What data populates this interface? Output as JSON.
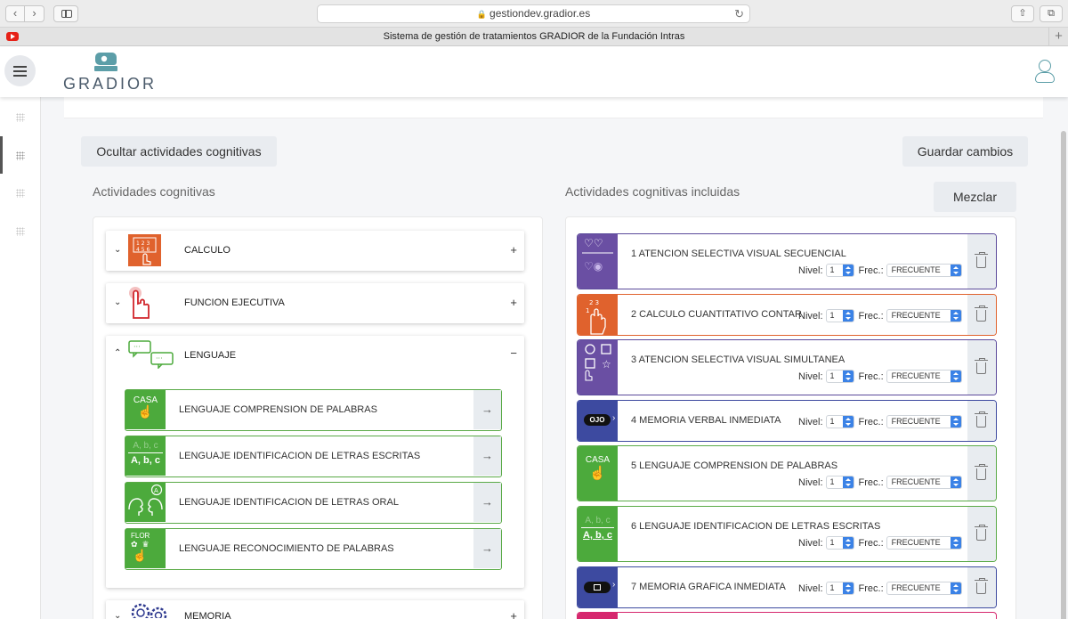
{
  "browser": {
    "url": "gestiondev.gradior.es",
    "tab_title": "Sistema de gestión de tratamientos GRADIOR de la Fundación Intras"
  },
  "header": {
    "logo_text": "GRADIOR",
    "brand_color": "#5c9ea8"
  },
  "toolbar": {
    "hide_label": "Ocultar actividades cognitivas",
    "save_label": "Guardar cambios",
    "mix_label": "Mezclar"
  },
  "left": {
    "title": "Actividades cognitivas",
    "categories": [
      {
        "label": "CALCULO",
        "toggle": "+",
        "icon": "calculator-hand-icon"
      },
      {
        "label": "FUNCION EJECUTIVA",
        "toggle": "+",
        "icon": "pointing-hand-icon"
      },
      {
        "label": "LENGUAJE",
        "toggle": "−",
        "icon": "speech-bubbles-icon"
      },
      {
        "label": "MEMORIA",
        "toggle": "+",
        "icon": "gears-icon"
      }
    ],
    "lenguaje_items": [
      {
        "label": "LENGUAJE COMPRENSION DE PALABRAS",
        "thumb": "CASA"
      },
      {
        "label": "LENGUAJE IDENTIFICACION DE LETRAS ESCRITAS",
        "thumb": "A, b, c"
      },
      {
        "label": "LENGUAJE IDENTIFICACION DE LETRAS ORAL",
        "thumb": "A"
      },
      {
        "label": "LENGUAJE RECONOCIMIENTO DE PALABRAS",
        "thumb": "FLOR"
      }
    ]
  },
  "right": {
    "title": "Actividades cognitivas incluidas",
    "nivel_label": "Nivel:",
    "frec_label": "Frec.:",
    "activities": [
      {
        "name": "1 ATENCION SELECTIVA VISUAL SECUENCIAL",
        "nivel": "1",
        "frec": "FRECUENTE",
        "color": "#6a4fa3",
        "border": "#5b4a9b"
      },
      {
        "name": "2 CALCULO CUANTITATIVO CONTAR",
        "nivel": "1",
        "frec": "FRECUENTE",
        "color": "#e0622d",
        "border": "#e0622d"
      },
      {
        "name": "3 ATENCION SELECTIVA VISUAL SIMULTANEA",
        "nivel": "1",
        "frec": "FRECUENTE",
        "color": "#6a4fa3",
        "border": "#5b4a9b"
      },
      {
        "name": "4 MEMORIA VERBAL INMEDIATA",
        "nivel": "1",
        "frec": "FRECUENTE",
        "color": "#3d4aa0",
        "border": "#3d4aa0",
        "thumb": "OJO"
      },
      {
        "name": "5 LENGUAJE COMPRENSION DE PALABRAS",
        "nivel": "1",
        "frec": "FRECUENTE",
        "color": "#4caa3c",
        "border": "#5aaa47",
        "thumb": "CASA"
      },
      {
        "name": "6 LENGUAJE IDENTIFICACION DE LETRAS ESCRITAS",
        "nivel": "1",
        "frec": "FRECUENTE",
        "color": "#4caa3c",
        "border": "#5aaa47",
        "thumb": "A, b, c"
      },
      {
        "name": "7 MEMORIA GRAFICA INMEDIATA",
        "nivel": "1",
        "frec": "FRECUENTE",
        "color": "#3d4aa0",
        "border": "#3d4aa0"
      }
    ]
  }
}
